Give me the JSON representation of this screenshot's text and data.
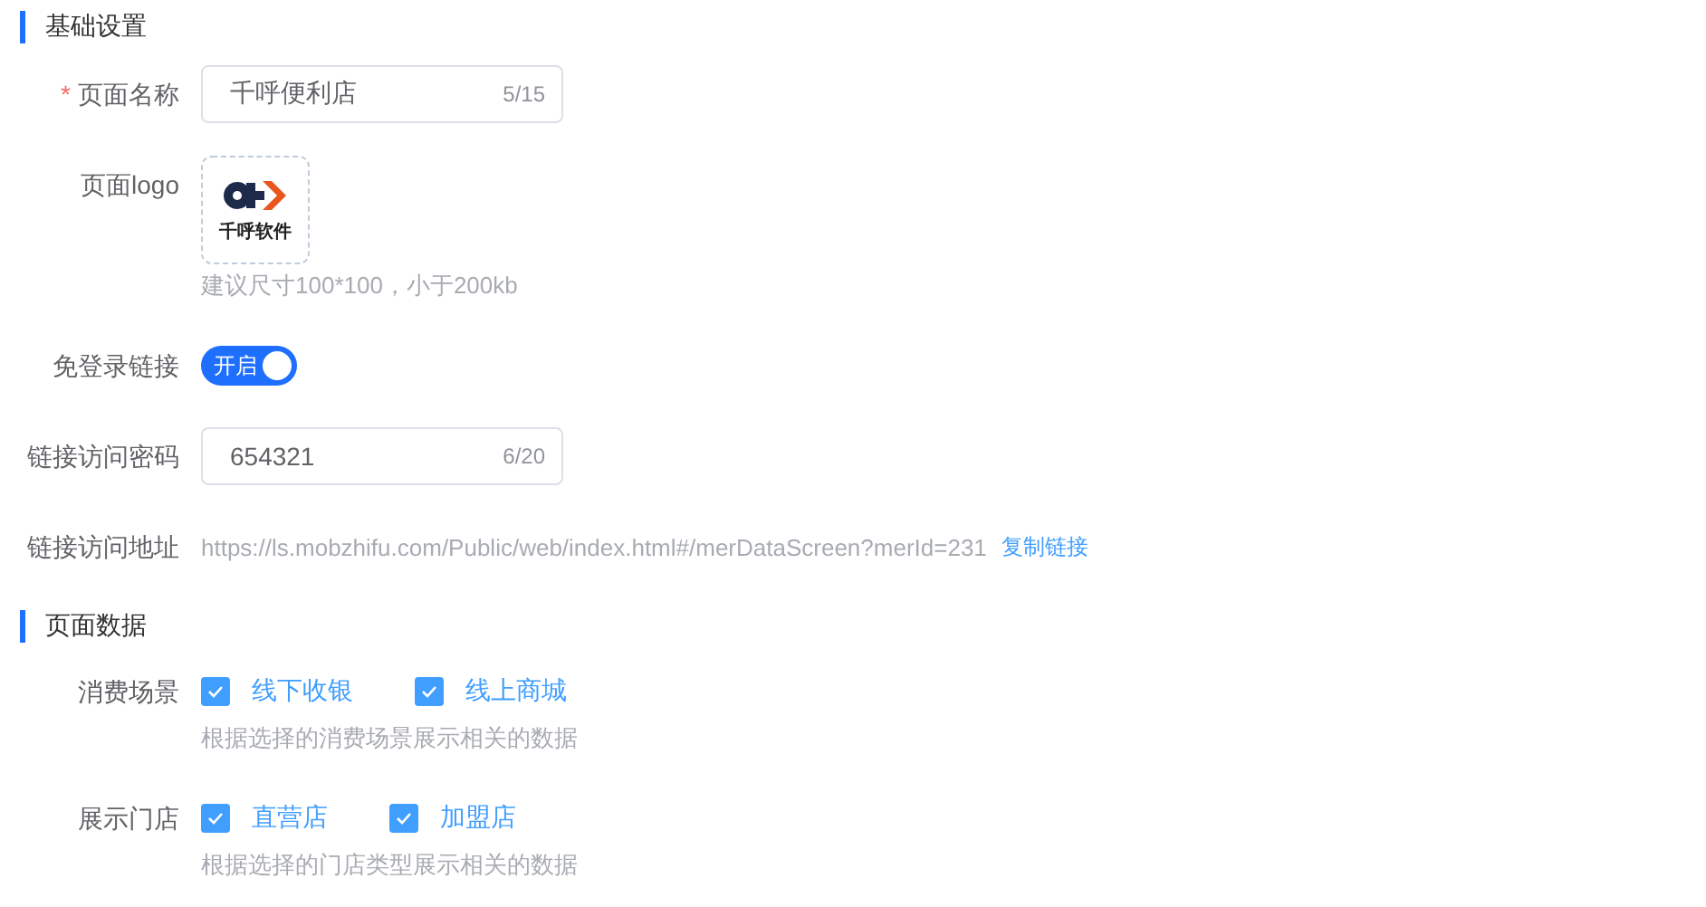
{
  "basic": {
    "title": "基础设置",
    "page_name": {
      "required_mark": "*",
      "label": "页面名称",
      "value": "千呼便利店",
      "count": "5/15"
    },
    "logo": {
      "label": "页面logo",
      "logo_text": "千呼软件",
      "hint": "建议尺寸100*100，小于200kb"
    },
    "free_login": {
      "label": "免登录链接",
      "on": true,
      "text": "开启"
    },
    "password": {
      "label": "链接访问密码",
      "value": "654321",
      "count": "6/20"
    },
    "url": {
      "label": "链接访问地址",
      "value": "https://ls.mobzhifu.com/Public/web/index.html#/merDataScreen?merId=231",
      "copy_link": "复制链接"
    }
  },
  "page_data": {
    "title": "页面数据",
    "groups": [
      {
        "label": "消费场景",
        "options": [
          {
            "label": "线下收银",
            "checked": true
          },
          {
            "label": "线上商城",
            "checked": true
          }
        ],
        "hint": "根据选择的消费场景展示相关的数据"
      },
      {
        "label": "展示门店",
        "options": [
          {
            "label": "直营店",
            "checked": true
          },
          {
            "label": "加盟店",
            "checked": true
          }
        ],
        "hint": "根据选择的门店类型展示相关的数据"
      }
    ]
  }
}
